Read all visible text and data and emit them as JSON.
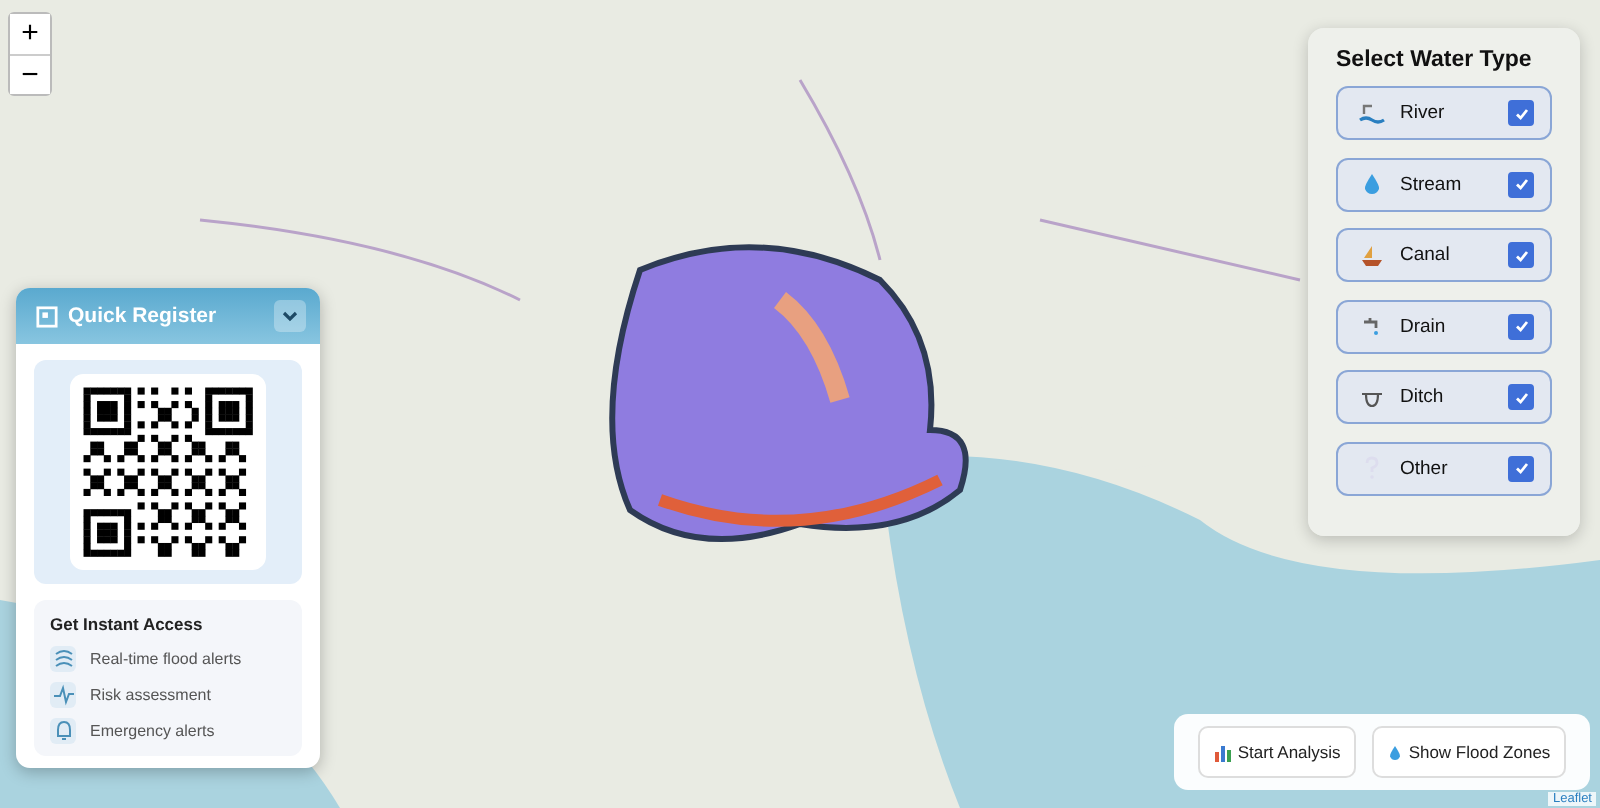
{
  "map_controls": {
    "zoom_in": "+",
    "zoom_out": "−",
    "attribution": "Leaflet"
  },
  "register_panel": {
    "title": "Quick Register",
    "expanded": true,
    "heading": "Get Instant Access",
    "features": [
      {
        "kind": "alerts",
        "label": "Real-time flood alerts"
      },
      {
        "kind": "risk",
        "label": "Risk assessment"
      },
      {
        "kind": "emergency",
        "label": "Emergency alerts"
      }
    ]
  },
  "water_type_panel": {
    "title": "Select Water Type",
    "types": [
      {
        "kind": "river",
        "label": "River",
        "checked": true
      },
      {
        "kind": "stream",
        "label": "Stream",
        "checked": true
      },
      {
        "kind": "canal",
        "label": "Canal",
        "checked": true
      },
      {
        "kind": "drain",
        "label": "Drain",
        "checked": true
      },
      {
        "kind": "ditch",
        "label": "Ditch",
        "checked": true
      },
      {
        "kind": "other",
        "label": "Other",
        "checked": true
      }
    ]
  },
  "actions": [
    {
      "kind": "analysis",
      "label": "Start Analysis"
    },
    {
      "kind": "flood",
      "label": "Show Flood Zones"
    }
  ]
}
